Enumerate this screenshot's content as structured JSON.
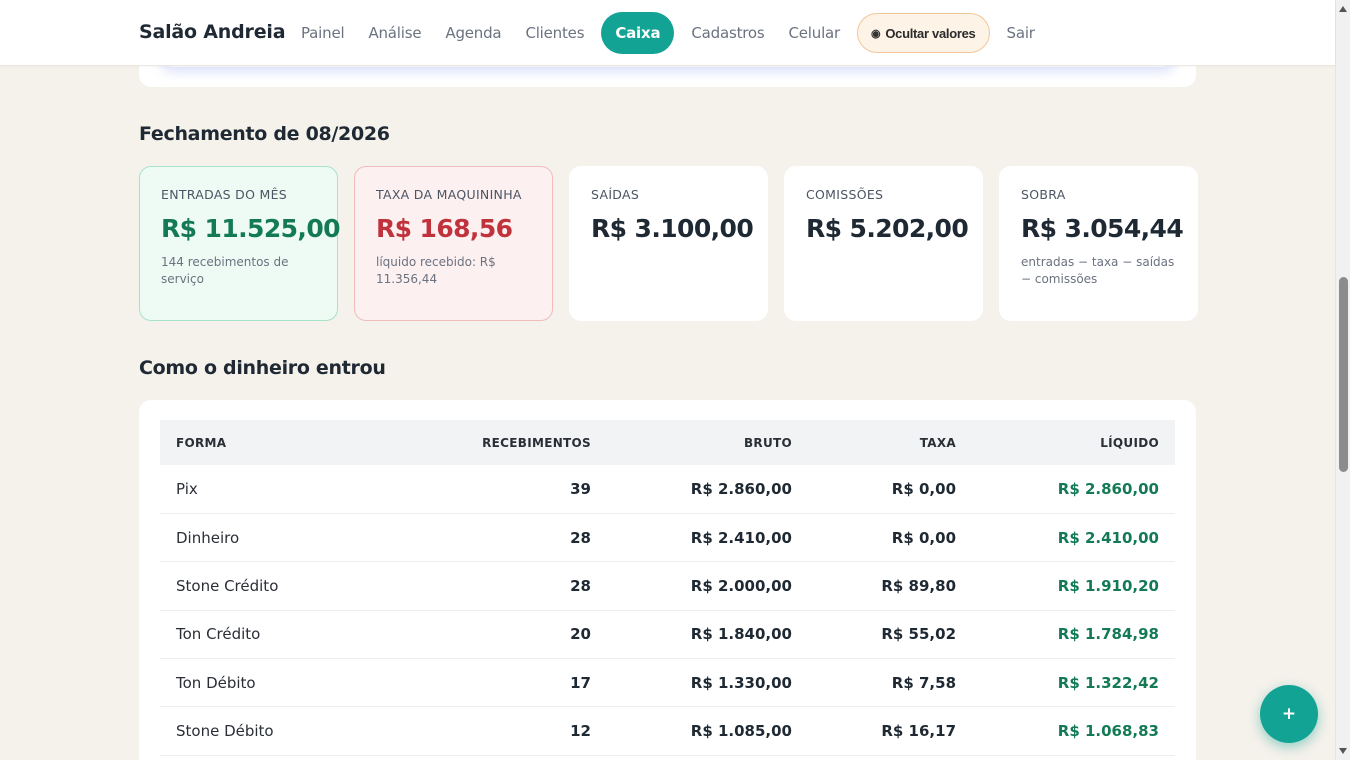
{
  "header": {
    "brand": "Salão Andreia",
    "nav": [
      "Painel",
      "Análise",
      "Agenda",
      "Clientes",
      "Caixa",
      "Cadastros",
      "Celular"
    ],
    "active": "Caixa",
    "hide_values_label": "Ocultar valores",
    "logout": "Sair"
  },
  "summary": {
    "title": "Fechamento de 08/2026",
    "cards": [
      {
        "label": "ENTRADAS DO MÊS",
        "value": "R$ 11.525,00",
        "sub": "144 recebimentos de serviço"
      },
      {
        "label": "TAXA DA MAQUININHA",
        "value": "R$ 168,56",
        "sub": "líquido recebido: R$ 11.356,44"
      },
      {
        "label": "SAÍDAS",
        "value": "R$ 3.100,00",
        "sub": ""
      },
      {
        "label": "COMISSÕES",
        "value": "R$ 5.202,00",
        "sub": ""
      },
      {
        "label": "SOBRA",
        "value": "R$ 3.054,44",
        "sub": "entradas − taxa − saídas − comissões"
      }
    ]
  },
  "income": {
    "title": "Como o dinheiro entrou",
    "columns": [
      "FORMA",
      "RECEBIMENTOS",
      "BRUTO",
      "TAXA",
      "LÍQUIDO"
    ],
    "rows": [
      [
        "Pix",
        "39",
        "R$ 2.860,00",
        "R$ 0,00",
        "R$ 2.860,00"
      ],
      [
        "Dinheiro",
        "28",
        "R$ 2.410,00",
        "R$ 0,00",
        "R$ 2.410,00"
      ],
      [
        "Stone Crédito",
        "28",
        "R$ 2.000,00",
        "R$ 89,80",
        "R$ 1.910,20"
      ],
      [
        "Ton Crédito",
        "20",
        "R$ 1.840,00",
        "R$ 55,02",
        "R$ 1.784,98"
      ],
      [
        "Ton Débito",
        "17",
        "R$ 1.330,00",
        "R$ 7,58",
        "R$ 1.322,42"
      ],
      [
        "Stone Débito",
        "12",
        "R$ 1.085,00",
        "R$ 16,17",
        "R$ 1.068,83"
      ]
    ]
  },
  "fab_label": "+",
  "colors": {
    "accent": "#13a394",
    "positive": "#137a55",
    "negative": "#c0323c"
  }
}
